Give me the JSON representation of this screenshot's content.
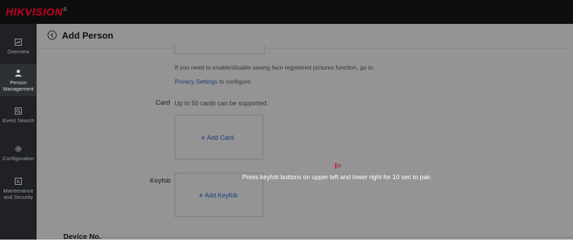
{
  "brand": {
    "logo_text": "HIKVISION",
    "reg_mark": "®",
    "logo_color": "#c6001e"
  },
  "sidebar": {
    "items": [
      {
        "label": "Overview",
        "icon": "overview-icon",
        "active": false
      },
      {
        "label": "Person Management",
        "icon": "person-icon",
        "active": true
      },
      {
        "label": "Event Search",
        "icon": "event-search-icon",
        "active": false
      },
      {
        "label": "Configuration",
        "icon": "gear-icon",
        "active": false
      },
      {
        "label": "Maintenance and Security",
        "icon": "maintenance-icon",
        "active": false
      }
    ]
  },
  "header": {
    "title": "Add Person"
  },
  "face": {
    "hint_line1": "If you need to enable/disable saving face registered pictures function, go to",
    "privacy_link": "Privacy Settings",
    "hint_line2_suffix": " to configure."
  },
  "card": {
    "label": "Card",
    "hint": "Up to 50 cards can be supported.",
    "add_label": "Add Card"
  },
  "keyfob": {
    "label": "Keyfob",
    "add_label": "Add Keyfob"
  },
  "device": {
    "section_title": "Device No."
  },
  "overlay": {
    "message": "Press keyfob buttons on upper left and lower right for 10 sec to pair.",
    "accent": "#e0192e"
  },
  "colors": {
    "topbar": "#0d0d0f",
    "sidebar": "#1f2124",
    "link": "#2d6ad6"
  }
}
